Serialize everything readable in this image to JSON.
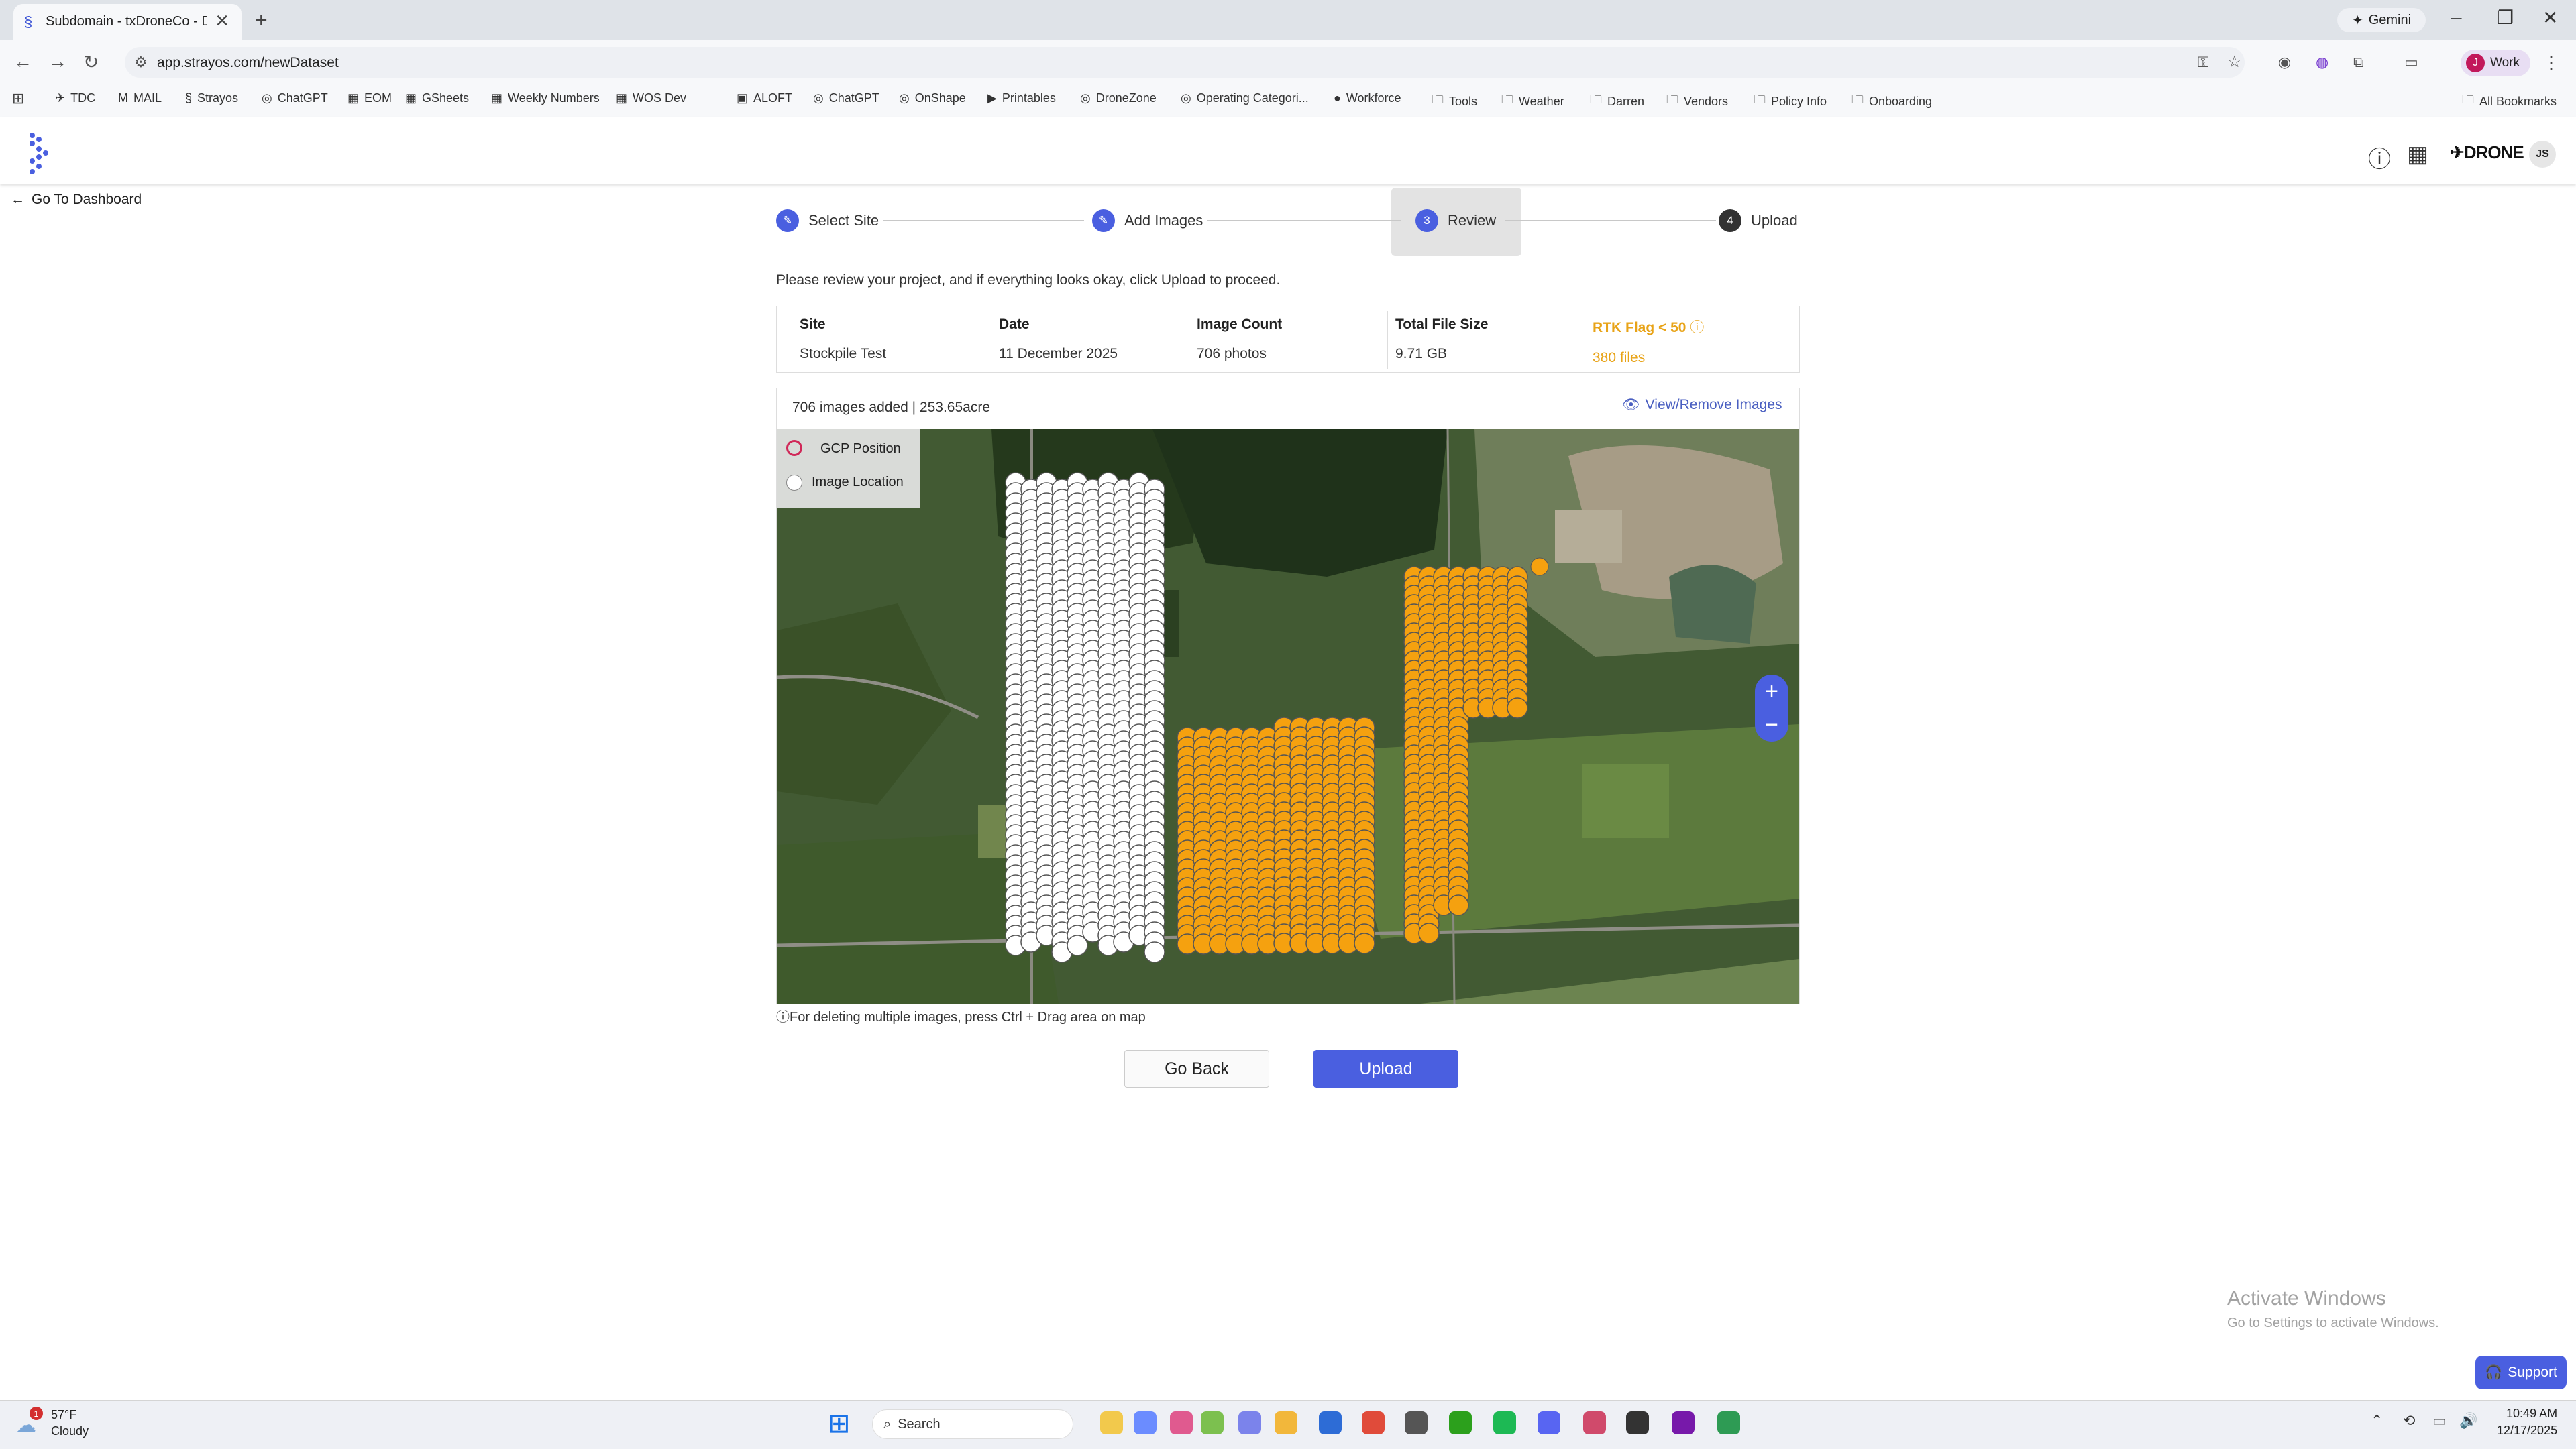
{
  "browser": {
    "tab_title": "Subdomain - txDroneCo - Dem",
    "tab_close": "✕",
    "new_tab": "+",
    "gemini_label": "Gemini",
    "url": "app.strayos.com/newDataset",
    "profile_label": "Work",
    "profile_initial": "J",
    "bookmarks": [
      "TDC",
      "MAIL",
      "Strayos",
      "ChatGPT",
      "EOM",
      "GSheets",
      "Weekly Numbers",
      "WOS Dev",
      "ALOFT",
      "ChatGPT",
      "OnShape",
      "Printables",
      "DroneZone",
      "Operating Categori...",
      "Workforce",
      "Tools",
      "Weather",
      "Darren",
      "Vendors",
      "Policy Info",
      "Onboarding"
    ],
    "all_bookmarks": "All Bookmarks"
  },
  "header": {
    "brand": "DRONE",
    "user_initials": "JS"
  },
  "nav": {
    "back_label": "Go To Dashboard"
  },
  "steps": [
    {
      "label": "Select Site",
      "marker": "✎",
      "state": "done"
    },
    {
      "label": "Add Images",
      "marker": "✎",
      "state": "done"
    },
    {
      "label": "Review",
      "marker": "3",
      "state": "active"
    },
    {
      "label": "Upload",
      "marker": "4",
      "state": "pending"
    }
  ],
  "instruction": "Please review your project, and if everything looks okay, click Upload to proceed.",
  "summary": {
    "site_h": "Site",
    "site_v": "Stockpile Test",
    "date_h": "Date",
    "date_v": "11 December 2025",
    "count_h": "Image Count",
    "count_v": "706 photos",
    "size_h": "Total File Size",
    "size_v": "9.71 GB",
    "rtk_h": "RTK Flag < 50",
    "rtk_v": "380 files"
  },
  "map_panel": {
    "info": "706 images added | 253.65acre",
    "view_remove": "View/Remove Images",
    "legend_gcp": "GCP Position",
    "legend_image": "Image Location",
    "zoom_in": "+",
    "zoom_out": "−",
    "note": "For deleting multiple images, press Ctrl + Drag area on map"
  },
  "actions": {
    "go_back": "Go Back",
    "upload": "Upload"
  },
  "watermark": {
    "line1": "Activate Windows",
    "line2": "Go to Settings to activate Windows."
  },
  "support_label": "Support",
  "taskbar": {
    "weather_temp": "57°F",
    "weather_desc": "Cloudy",
    "weather_badge": "1",
    "search": "Search",
    "time": "10:49 AM",
    "date": "12/17/2025"
  },
  "colors": {
    "accent": "#4a5fe0",
    "rtk": "#e8a317",
    "image_white": "#ffffff",
    "image_orange": "#f5a10f"
  }
}
